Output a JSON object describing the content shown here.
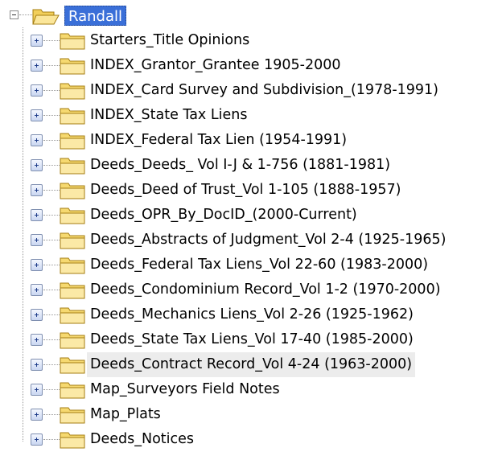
{
  "tree": {
    "root": {
      "label": "Randall",
      "icon": "folder-open-icon",
      "expanded": true,
      "selected": true
    },
    "children": [
      {
        "label": "Starters_Title Opinions"
      },
      {
        "label": "INDEX_Grantor_Grantee 1905-2000"
      },
      {
        "label": "INDEX_Card Survey and Subdivision_(1978-1991)"
      },
      {
        "label": "INDEX_State Tax Liens"
      },
      {
        "label": "INDEX_Federal Tax Lien (1954-1991)"
      },
      {
        "label": "Deeds_Deeds_ Vol I-J & 1-756 (1881-1981)"
      },
      {
        "label": "Deeds_Deed of Trust_Vol 1-105 (1888-1957)"
      },
      {
        "label": "Deeds_OPR_By_DocID_(2000-Current)"
      },
      {
        "label": "Deeds_Abstracts of Judgment_Vol 2-4 (1925-1965)"
      },
      {
        "label": "Deeds_Federal Tax Liens_Vol 22-60 (1983-2000)"
      },
      {
        "label": "Deeds_Condominium Record_Vol 1-2 (1970-2000)"
      },
      {
        "label": "Deeds_Mechanics Liens_Vol 2-26 (1925-1962)"
      },
      {
        "label": "Deeds_State Tax Liens_Vol 17-40 (1985-2000)"
      },
      {
        "label": "Deeds_Contract Record_Vol 4-24 (1963-2000)",
        "hovered": true
      },
      {
        "label": "Map_Surveyors Field Notes"
      },
      {
        "label": "Map_Plats"
      },
      {
        "label": "Deeds_Notices"
      }
    ],
    "child_icon": "folder-closed-icon",
    "expander_icon": "plus-expander-icon"
  },
  "colors": {
    "selection": "#3a6fd8",
    "folder_fill": "#f9e08a",
    "folder_stroke": "#b08a1e",
    "hover": "#ececec"
  }
}
